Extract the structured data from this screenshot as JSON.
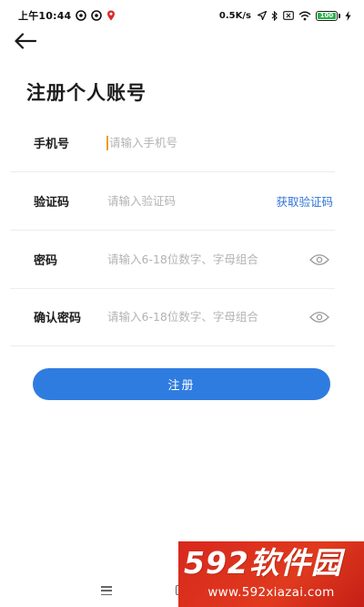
{
  "status_bar": {
    "time": "上午10:44",
    "network_speed": "0.5K/s",
    "battery_label": "100",
    "battery_level": 1.0,
    "icons": [
      "at-icon",
      "at-icon",
      "location-pin-icon",
      "send-icon",
      "bluetooth-icon",
      "sim-off-icon",
      "wifi-icon",
      "battery-icon",
      "charging-icon"
    ]
  },
  "header": {
    "back_icon": "arrow-left-icon",
    "title": "注册个人账号"
  },
  "form": {
    "phone": {
      "label": "手机号",
      "placeholder": "请输入手机号",
      "value": ""
    },
    "code": {
      "label": "验证码",
      "placeholder": "请输入验证码",
      "value": "",
      "action_label": "获取验证码"
    },
    "password": {
      "label": "密码",
      "placeholder": "请输入6-18位数字、字母组合",
      "value": "",
      "toggle_icon": "eye-icon"
    },
    "confirm_password": {
      "label": "确认密码",
      "placeholder": "请输入6-18位数字、字母组合",
      "value": "",
      "toggle_icon": "eye-icon"
    }
  },
  "submit_label": "注册",
  "nav_bar": {
    "icons": [
      "menu-icon",
      "home-square-icon"
    ]
  },
  "watermark": {
    "logo": "592软件园",
    "url": "www.592xiazai.com"
  },
  "colors": {
    "accent": "#2f7ce0",
    "link": "#2f74d8",
    "caret": "#e9a023",
    "watermark_bg": "#d8281d",
    "battery_fill": "#2ab34a"
  }
}
